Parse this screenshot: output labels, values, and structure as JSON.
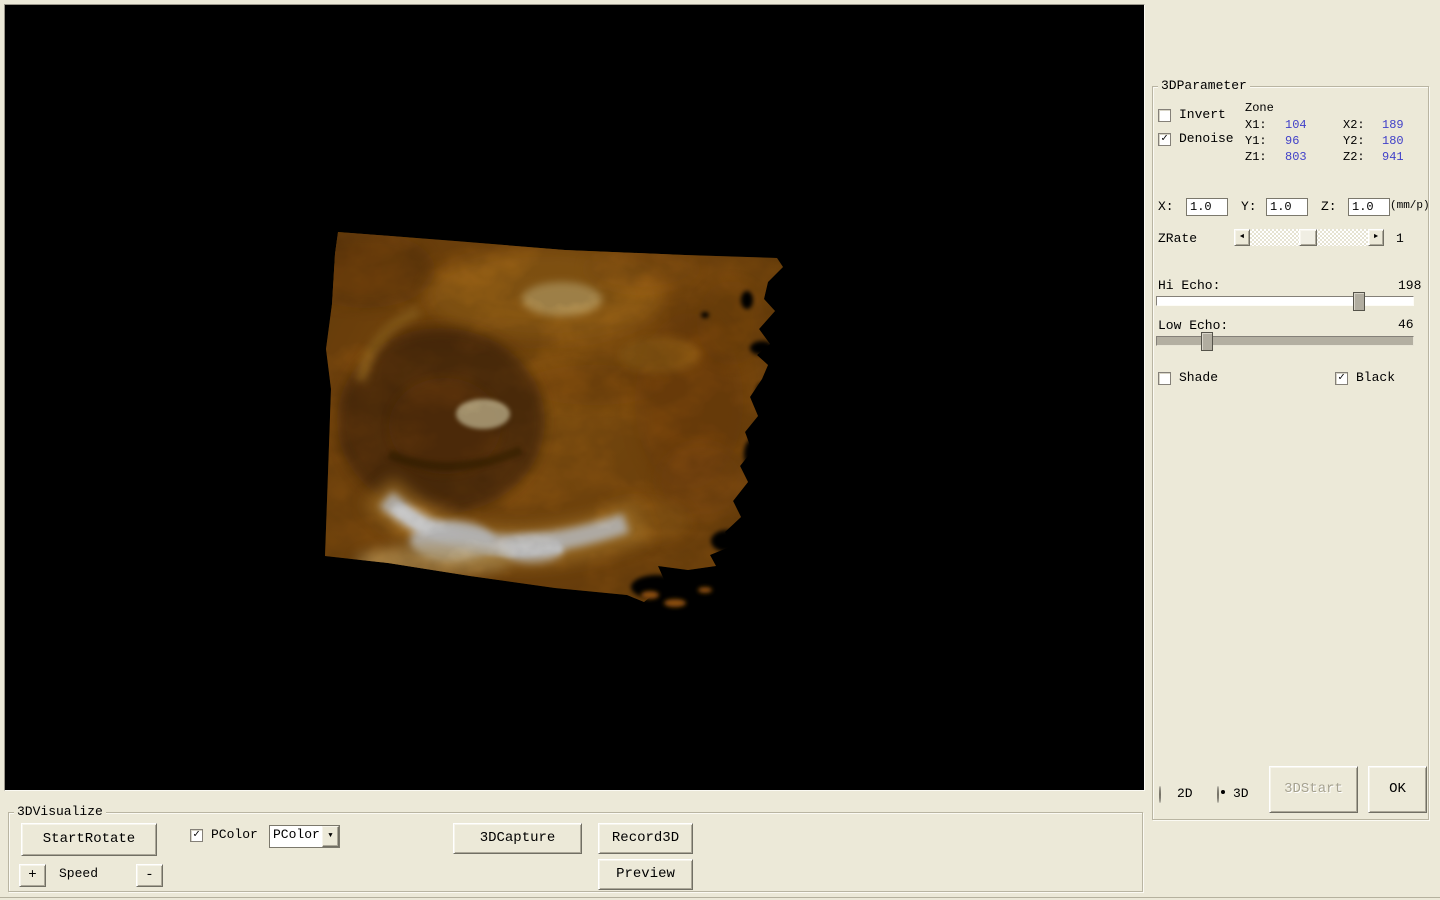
{
  "icons": {
    "check": "✓",
    "dropdown_arrow": "▼",
    "scroll_left_arrow": "◄",
    "scroll_right_arrow": "►"
  },
  "viewport": {
    "description": "3D ultrasound volume render on black background"
  },
  "parameter_panel": {
    "group_title": "3DParameter",
    "invert": {
      "label": "Invert",
      "checked": false
    },
    "denoise": {
      "label": "Denoise",
      "checked": true
    },
    "zone": {
      "title": "Zone",
      "value_color": "#4040c8",
      "rows": [
        {
          "l1": "X1:",
          "v1": "104",
          "l2": "X2:",
          "v2": "189"
        },
        {
          "l1": "Y1:",
          "v1": "96",
          "l2": "Y2:",
          "v2": "180"
        },
        {
          "l1": "Z1:",
          "v1": "803",
          "l2": "Z2:",
          "v2": "941"
        }
      ]
    },
    "scale": {
      "x_label": "X:",
      "x_value": "1.0",
      "y_label": "Y:",
      "y_value": "1.0",
      "z_label": "Z:",
      "z_value": "1.0",
      "unit_label": "(mm/p)"
    },
    "zrate": {
      "label": "ZRate",
      "value": "1"
    },
    "hi_echo": {
      "label": "Hi Echo:",
      "value": "198"
    },
    "low_echo": {
      "label": "Low Echo:",
      "value": "46"
    },
    "shade": {
      "label": "Shade",
      "checked": false
    },
    "black": {
      "label": "Black",
      "checked": true
    },
    "mode": {
      "options": [
        {
          "label": "2D",
          "selected": false
        },
        {
          "label": "3D",
          "selected": true
        }
      ]
    },
    "start3d_button": {
      "label": "3DStart",
      "enabled": false
    },
    "ok_button": {
      "label": "OK"
    }
  },
  "visualize_panel": {
    "group_title": "3DVisualize",
    "start_rotate_button": "StartRotate",
    "speed_plus_button": "+",
    "speed_label": "Speed",
    "speed_minus_button": "-",
    "pcolor_checkbox": {
      "label": "PColor",
      "checked": true
    },
    "pcolor_dropdown": {
      "value": "PColor"
    },
    "capture_button": "3DCapture",
    "record_button": "Record3D",
    "preview_button": "Preview"
  }
}
